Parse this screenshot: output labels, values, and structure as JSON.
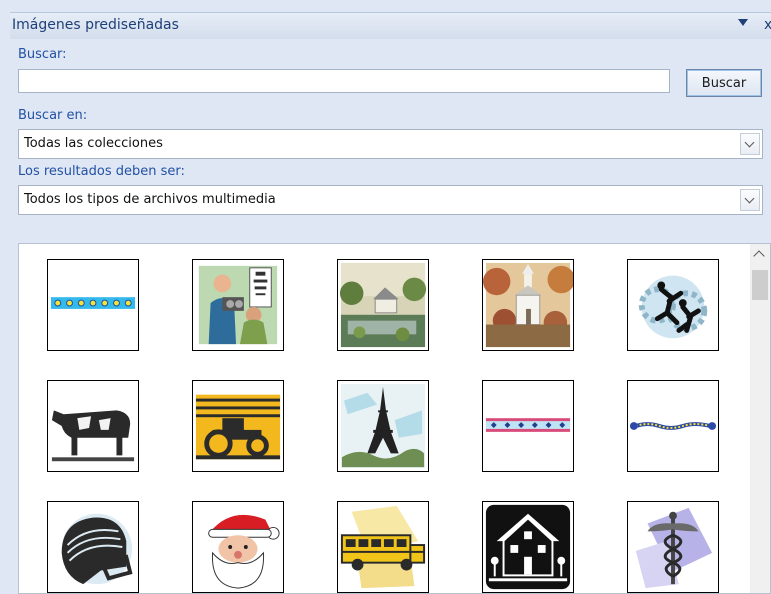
{
  "pane": {
    "title": "Imágenes prediseñadas",
    "close_glyph": "x"
  },
  "search": {
    "label": "Buscar:",
    "value": "",
    "button_label": "Buscar"
  },
  "search_in": {
    "label": "Buscar en:",
    "selected": "Todas las colecciones"
  },
  "results_type": {
    "label": "Los resultados deben ser:",
    "selected": "Todos los tipos de archivos multimedia"
  },
  "clips": [
    {
      "name": "dotted-border-clip"
    },
    {
      "name": "eye-doctor-clip"
    },
    {
      "name": "cottage-pond-clip"
    },
    {
      "name": "church-autumn-clip"
    },
    {
      "name": "gears-people-clip"
    },
    {
      "name": "cow-clip"
    },
    {
      "name": "tractor-clip"
    },
    {
      "name": "eiffel-tower-clip"
    },
    {
      "name": "patterned-border-clip"
    },
    {
      "name": "beaded-line-clip"
    },
    {
      "name": "football-helmet-clip"
    },
    {
      "name": "santa-claus-clip"
    },
    {
      "name": "school-bus-clip"
    },
    {
      "name": "house-icon-clip"
    },
    {
      "name": "caduceus-clip"
    }
  ],
  "colors": {
    "panel_bg": "#dfe7f4",
    "label_blue": "#2351a3",
    "title_blue": "#1e3f78"
  }
}
